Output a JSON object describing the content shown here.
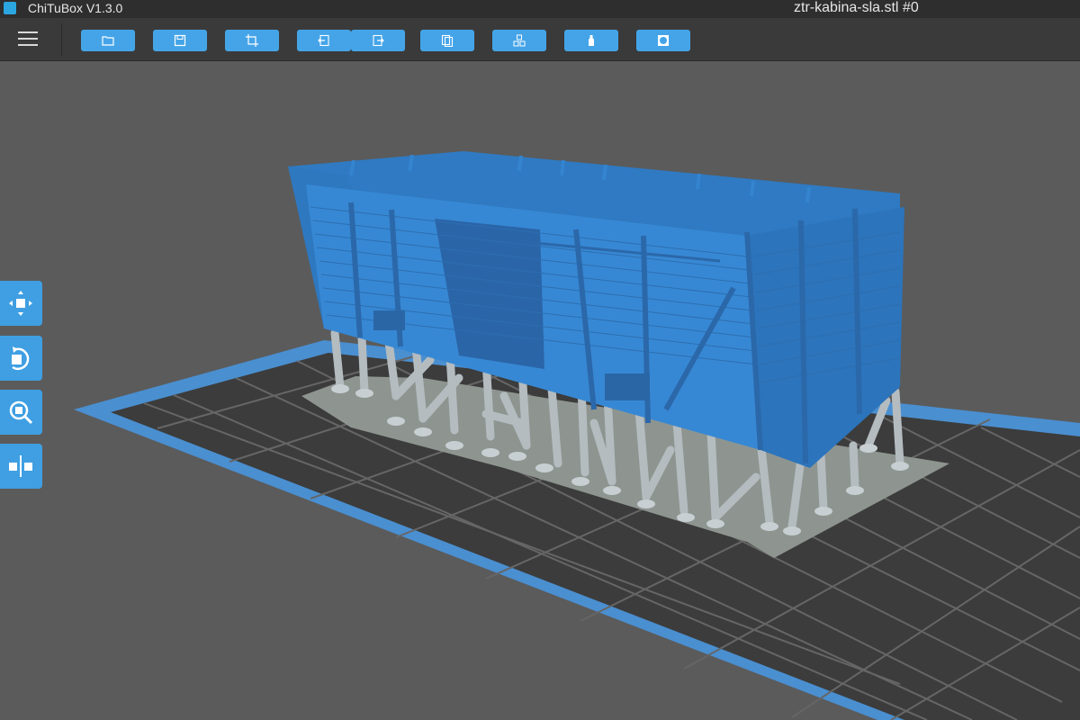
{
  "app": {
    "title": "ChiTuBox V1.3.0",
    "logo_icon": "chitubox-logo-icon"
  },
  "document": {
    "title": "ztr-kabina-sla.stl #0"
  },
  "toolbar": {
    "menu_icon": "hamburger-menu-icon",
    "buttons": [
      {
        "name": "open-file-button",
        "icon": "open-folder-icon"
      },
      {
        "name": "save-button",
        "icon": "save-icon"
      },
      {
        "name": "screenshot-button",
        "icon": "crop-frame-icon"
      },
      {
        "name": "undo-button",
        "icon": "undo-arrow-icon"
      },
      {
        "name": "redo-button",
        "icon": "redo-arrow-icon"
      },
      {
        "name": "copy-button",
        "icon": "copy-pages-icon"
      },
      {
        "name": "arrange-button",
        "icon": "cubes-stack-icon"
      },
      {
        "name": "support-button",
        "icon": "bottle-icon"
      },
      {
        "name": "hollow-button",
        "icon": "circle-square-icon"
      }
    ]
  },
  "sidebar": {
    "tools": [
      {
        "name": "move-tool-button",
        "icon": "move-cube-icon"
      },
      {
        "name": "rotate-tool-button",
        "icon": "rotate-cube-icon"
      },
      {
        "name": "scale-tool-button",
        "icon": "zoom-cube-icon"
      },
      {
        "name": "mirror-tool-button",
        "icon": "mirror-cube-icon"
      }
    ]
  },
  "colors": {
    "background": "#5b5b5b",
    "toolbar": "#3a3a3a",
    "titlebar": "#2e2e2e",
    "accent": "#45a4e8",
    "model": "#3484d0",
    "supports": "#b4bcc0",
    "plate_border": "#4a8fd0"
  }
}
